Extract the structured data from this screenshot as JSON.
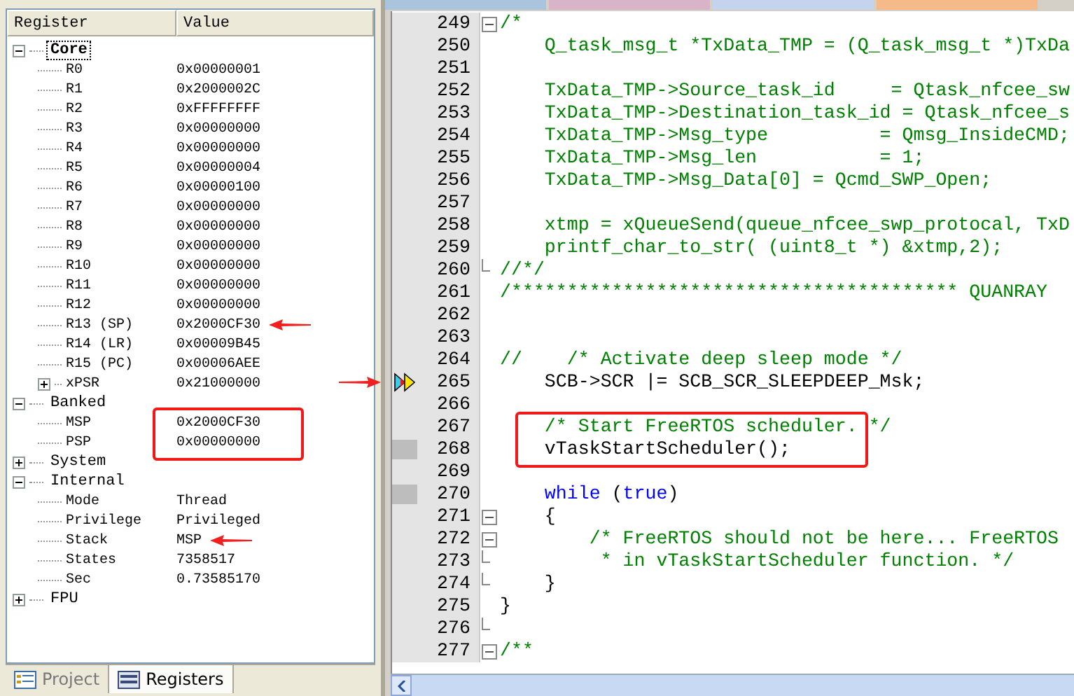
{
  "registers": {
    "columns": [
      "Register",
      "Value"
    ],
    "groups": [
      {
        "name": "Core",
        "expanded": true,
        "selected": true,
        "children": [
          {
            "name": "R0",
            "value": "0x00000001"
          },
          {
            "name": "R1",
            "value": "0x2000002C"
          },
          {
            "name": "R2",
            "value": "0xFFFFFFFF"
          },
          {
            "name": "R3",
            "value": "0x00000000"
          },
          {
            "name": "R4",
            "value": "0x00000000"
          },
          {
            "name": "R5",
            "value": "0x00000004"
          },
          {
            "name": "R6",
            "value": "0x00000100"
          },
          {
            "name": "R7",
            "value": "0x00000000"
          },
          {
            "name": "R8",
            "value": "0x00000000"
          },
          {
            "name": "R9",
            "value": "0x00000000"
          },
          {
            "name": "R10",
            "value": "0x00000000"
          },
          {
            "name": "R11",
            "value": "0x00000000"
          },
          {
            "name": "R12",
            "value": "0x00000000"
          },
          {
            "name": "R13 (SP)",
            "value": "0x2000CF30",
            "pointed": true
          },
          {
            "name": "R14 (LR)",
            "value": "0x00009B45"
          },
          {
            "name": "R15 (PC)",
            "value": "0x00006AEE"
          },
          {
            "name": "xPSR",
            "value": "0x21000000",
            "expanded": false
          }
        ]
      },
      {
        "name": "Banked",
        "expanded": true,
        "selected": false,
        "values_boxed": true,
        "children": [
          {
            "name": "MSP",
            "value": "0x2000CF30"
          },
          {
            "name": "PSP",
            "value": "0x00000000"
          }
        ]
      },
      {
        "name": "System",
        "expanded": false,
        "selected": false
      },
      {
        "name": "Internal",
        "expanded": true,
        "selected": false,
        "children": [
          {
            "name": "Mode",
            "value": "Thread"
          },
          {
            "name": "Privilege",
            "value": "Privileged"
          },
          {
            "name": "Stack",
            "value": "MSP",
            "pointed": true
          },
          {
            "name": "States",
            "value": "7358517"
          },
          {
            "name": "Sec",
            "value": "0.73585170"
          }
        ]
      },
      {
        "name": "FPU",
        "expanded": false,
        "selected": false
      }
    ]
  },
  "panel_tabs": [
    {
      "label": "Project",
      "selected": false
    },
    {
      "label": "Registers",
      "selected": true
    }
  ],
  "editor": {
    "file_tabs": [
      {
        "color": "#a9c4dc"
      },
      {
        "color": "#d9b3c8"
      },
      {
        "color": "#c4d4ee"
      },
      {
        "color": "#f5b98a"
      }
    ],
    "lines": [
      {
        "number": "249",
        "fold_start": true,
        "segments": [
          {
            "kind": "comment",
            "text": "/*"
          }
        ]
      },
      {
        "number": "250",
        "segments": [
          {
            "kind": "comment",
            "text": "    Q_task_msg_t *TxData_TMP = (Q_task_msg_t *)TxDa"
          }
        ]
      },
      {
        "number": "251"
      },
      {
        "number": "252",
        "segments": [
          {
            "kind": "comment",
            "text": "    TxData_TMP->Source_task_id     = Qtask_nfcee_sw"
          }
        ]
      },
      {
        "number": "253",
        "segments": [
          {
            "kind": "comment",
            "text": "    TxData_TMP->Destination_task_id = Qtask_nfcee_s"
          }
        ]
      },
      {
        "number": "254",
        "segments": [
          {
            "kind": "comment",
            "text": "    TxData_TMP->Msg_type          = Qmsg_InsideCMD;"
          }
        ]
      },
      {
        "number": "255",
        "segments": [
          {
            "kind": "comment",
            "text": "    TxData_TMP->Msg_len           = 1;"
          }
        ]
      },
      {
        "number": "256",
        "segments": [
          {
            "kind": "comment",
            "text": "    TxData_TMP->Msg_Data[0] = Qcmd_SWP_Open;"
          }
        ]
      },
      {
        "number": "257"
      },
      {
        "number": "258",
        "segments": [
          {
            "kind": "comment",
            "text": "    xtmp = xQueueSend(queue_nfcee_swp_protocal, TxD"
          }
        ]
      },
      {
        "number": "259",
        "segments": [
          {
            "kind": "comment",
            "text": "    printf_char_to_str( (uint8_t *) &xtmp,2);"
          }
        ]
      },
      {
        "number": "260",
        "fold_end": true,
        "segments": [
          {
            "kind": "comment",
            "text": "//*/"
          }
        ]
      },
      {
        "number": "261",
        "segments": [
          {
            "kind": "comment",
            "text": "/**************************************** QUANRAY"
          }
        ]
      },
      {
        "number": "262"
      },
      {
        "number": "263"
      },
      {
        "number": "264",
        "segments": [
          {
            "kind": "comment",
            "text": "//    /* Activate deep sleep mode */"
          }
        ]
      },
      {
        "number": "265",
        "current": true,
        "pointed": true,
        "segments": [
          {
            "kind": "code",
            "text": "    SCB->SCR |= SCB_SCR_SLEEPDEEP_Msk;"
          }
        ]
      },
      {
        "number": "266"
      },
      {
        "number": "267",
        "boxed": true,
        "segments": [
          {
            "kind": "comment",
            "text": "    /* Start FreeRTOS scheduler. */"
          }
        ]
      },
      {
        "number": "268",
        "executed": true,
        "boxed": true,
        "segments": [
          {
            "kind": "code",
            "text": "    vTaskStartScheduler();"
          }
        ]
      },
      {
        "number": "269"
      },
      {
        "number": "270",
        "executed": true,
        "segments": [
          {
            "kind": "keyword",
            "text": "    while"
          },
          {
            "kind": "code",
            "text": " ("
          },
          {
            "kind": "keyword",
            "text": "true"
          },
          {
            "kind": "code",
            "text": ")"
          }
        ]
      },
      {
        "number": "271",
        "fold_start": true,
        "segments": [
          {
            "kind": "code",
            "text": "    {"
          }
        ]
      },
      {
        "number": "272",
        "fold_start": true,
        "segments": [
          {
            "kind": "comment",
            "text": "        /* FreeRTOS should not be here... FreeRTOS"
          }
        ]
      },
      {
        "number": "273",
        "fold_end": true,
        "segments": [
          {
            "kind": "comment",
            "text": "         * in vTaskStartScheduler function. */"
          }
        ]
      },
      {
        "number": "274",
        "fold_end": true,
        "segments": [
          {
            "kind": "code",
            "text": "    }"
          }
        ]
      },
      {
        "number": "275",
        "segments": [
          {
            "kind": "code",
            "text": "}"
          }
        ]
      },
      {
        "number": "276",
        "fold_end": true
      },
      {
        "number": "277",
        "fold_start": true,
        "segments": [
          {
            "kind": "comment",
            "text": "/**"
          }
        ]
      }
    ]
  }
}
